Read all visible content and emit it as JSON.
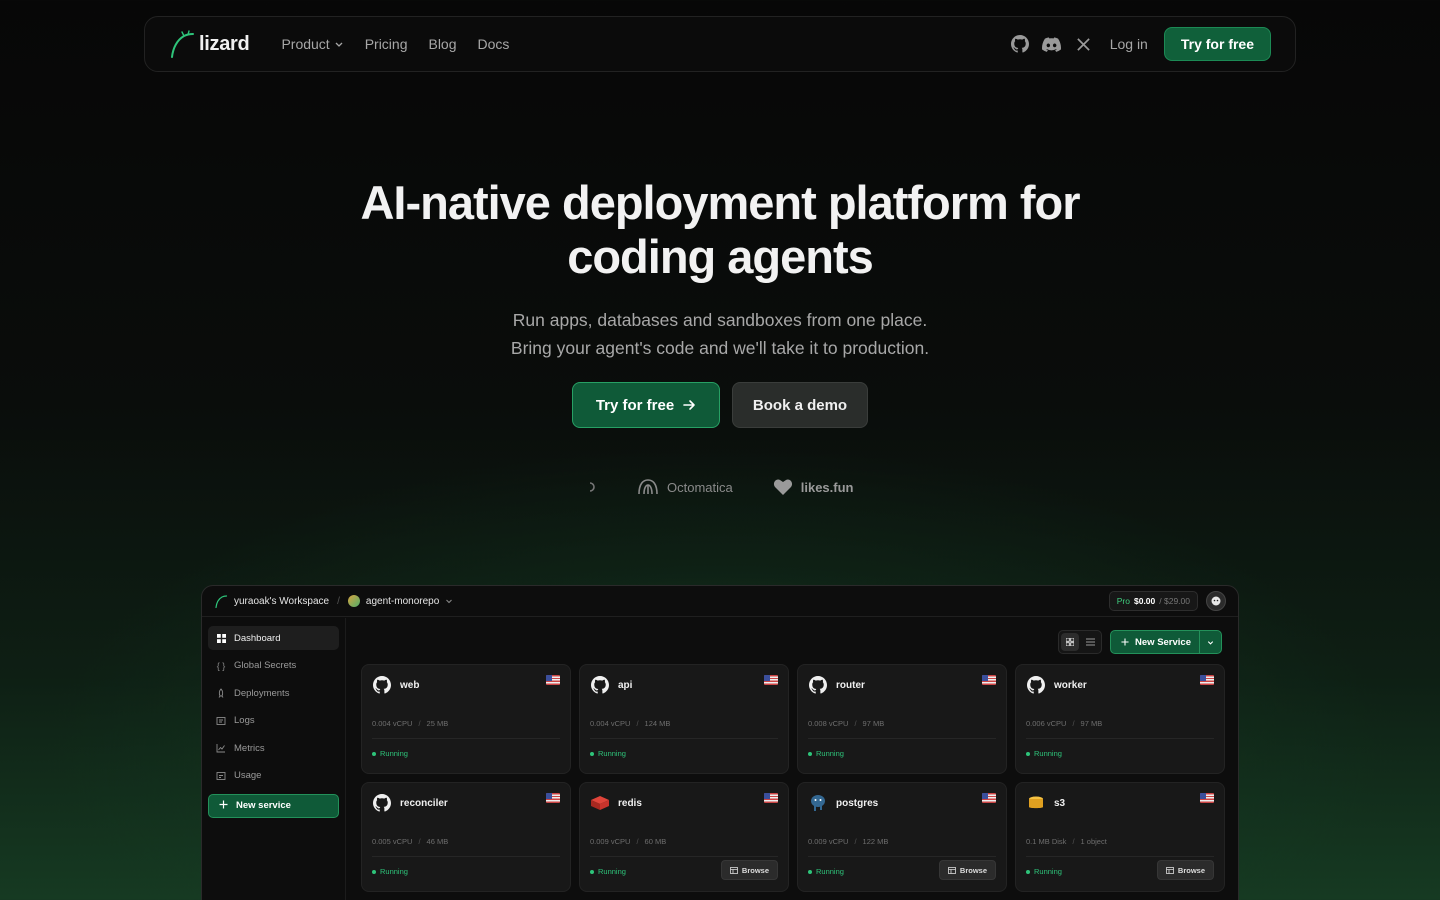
{
  "nav": {
    "logo_text": "lizard",
    "links": [
      {
        "label": "Product"
      },
      {
        "label": "Pricing"
      },
      {
        "label": "Blog"
      },
      {
        "label": "Docs"
      }
    ],
    "icons": [
      "github-icon",
      "discord-icon",
      "x-icon"
    ],
    "login_label": "Log in",
    "try_label": "Try for free"
  },
  "hero": {
    "title_line1": "AI-native deployment platform for",
    "title_line2": "coding agents",
    "subtitle_line1": "Run apps, databases and sandboxes from one place.",
    "subtitle_line2": "Bring your agent's code and we'll take it to production.",
    "cta_primary": "Try for free",
    "cta_secondary": "Book a demo"
  },
  "customer_logos": [
    {
      "name": "Octomatica"
    },
    {
      "name": "likes.fun"
    }
  ],
  "dashboard": {
    "workspace": "yuraoak's Workspace",
    "project": "agent-monorepo",
    "plan": {
      "tier": "Pro",
      "spent": "$0.00",
      "limit": "/ $29.00"
    },
    "sidebar": [
      {
        "label": "Dashboard",
        "icon": "grid-icon",
        "active": true
      },
      {
        "label": "Global Secrets",
        "icon": "braces-icon"
      },
      {
        "label": "Deployments",
        "icon": "rocket-icon"
      },
      {
        "label": "Logs",
        "icon": "logs-icon"
      },
      {
        "label": "Metrics",
        "icon": "chart-icon"
      },
      {
        "label": "Usage",
        "icon": "usage-icon"
      }
    ],
    "sidebar_new": "New service",
    "new_service_label": "New Service",
    "services": [
      {
        "name": "web",
        "kind": "github",
        "res1": "0.004 vCPU",
        "res2": "25 MB",
        "status": "Running"
      },
      {
        "name": "api",
        "kind": "github",
        "res1": "0.004 vCPU",
        "res2": "124 MB",
        "status": "Running"
      },
      {
        "name": "router",
        "kind": "github",
        "res1": "0.008 vCPU",
        "res2": "97 MB",
        "status": "Running"
      },
      {
        "name": "worker",
        "kind": "github",
        "res1": "0.006 vCPU",
        "res2": "97 MB",
        "status": "Running"
      },
      {
        "name": "reconciler",
        "kind": "github",
        "res1": "0.005 vCPU",
        "res2": "46 MB",
        "status": "Running"
      },
      {
        "name": "redis",
        "kind": "redis",
        "res1": "0.009 vCPU",
        "res2": "60 MB",
        "status": "Running",
        "browse": "Browse"
      },
      {
        "name": "postgres",
        "kind": "postgres",
        "res1": "0.009 vCPU",
        "res2": "122 MB",
        "status": "Running",
        "browse": "Browse"
      },
      {
        "name": "s3",
        "kind": "s3",
        "res1": "0.1 MB Disk",
        "res2": "1 object",
        "status": "Running",
        "browse": "Browse"
      }
    ]
  },
  "colors": {
    "accent": "#10603a",
    "accent_border": "#27a064",
    "status_running": "#2ec47a"
  }
}
